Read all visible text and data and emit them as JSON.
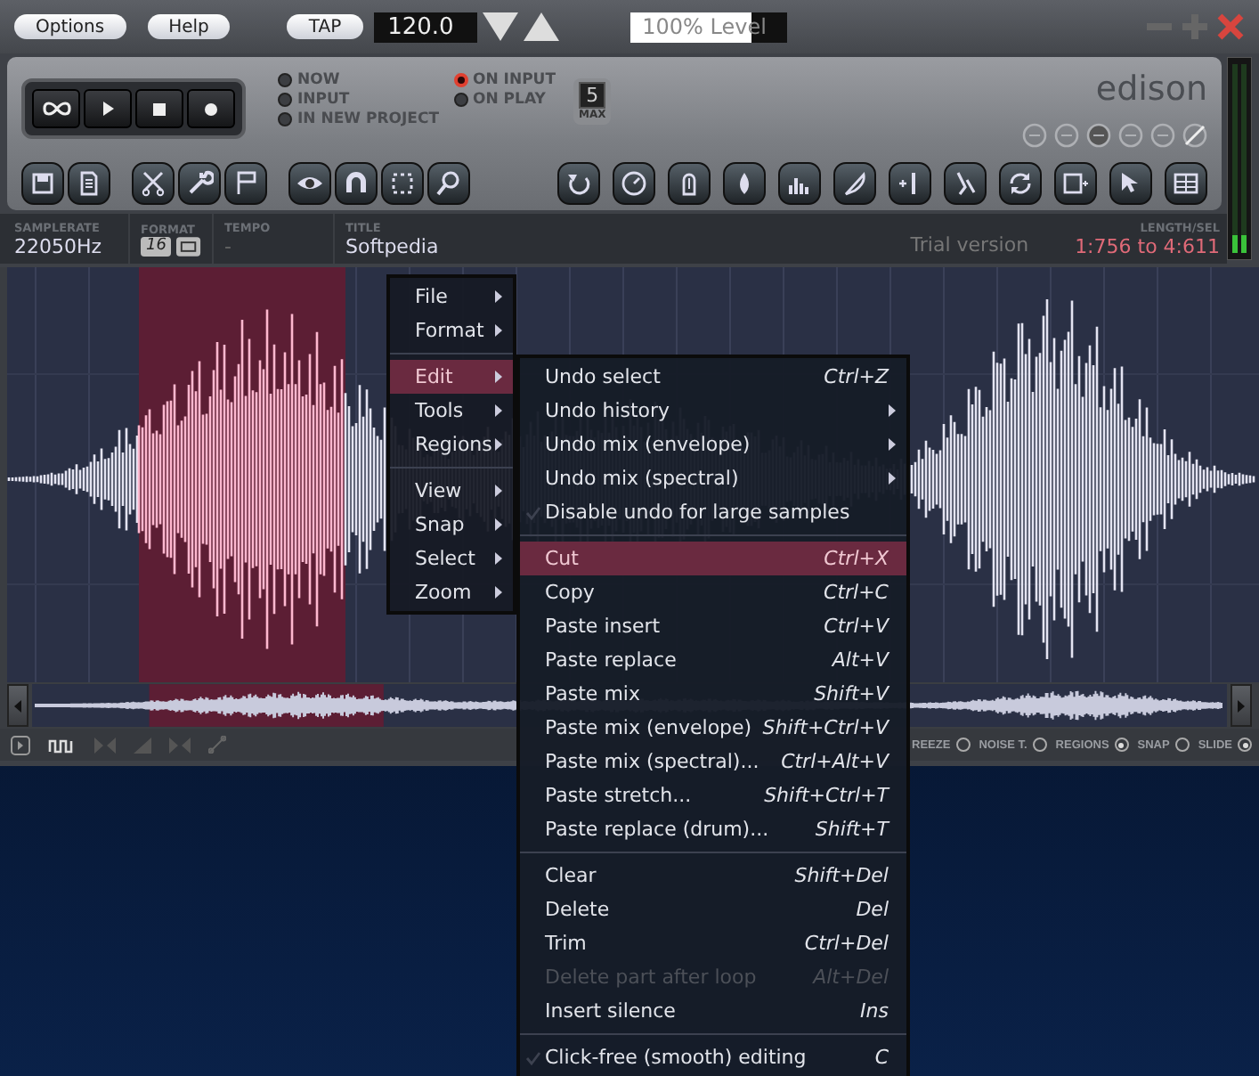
{
  "top_bar": {
    "buttons": [
      "Options",
      "Help",
      "TAP"
    ],
    "tempo": "120.0",
    "level_field": {
      "text": "100% Level",
      "level": 0.78
    }
  },
  "record_options": [
    {
      "label": "NOW",
      "selected": false
    },
    {
      "label": "INPUT",
      "selected": false
    },
    {
      "label": "IN NEW PROJECT",
      "selected": false
    },
    {
      "label": "ON INPUT",
      "selected": true
    },
    {
      "label": "ON PLAY",
      "selected": false
    }
  ],
  "max": {
    "value": "5",
    "label": "MAX"
  },
  "logo": "edison",
  "info": {
    "samplerate": {
      "label": "SAMPLERATE",
      "value": "22050Hz"
    },
    "format": {
      "label": "FORMAT",
      "bits": "16"
    },
    "tempo": {
      "label": "TEMPO",
      "value": "-"
    },
    "title": {
      "label": "TITLE",
      "value": "Softpedia"
    },
    "trial": "Trial version",
    "length": {
      "label": "LENGTH/SEL",
      "value": "1:756 to 4:611"
    }
  },
  "bottom_toggles": [
    {
      "label": "REEZE",
      "selected": false
    },
    {
      "label": "NOISE T.",
      "selected": false
    },
    {
      "label": "REGIONS",
      "selected": true
    },
    {
      "label": "SNAP",
      "selected": false
    },
    {
      "label": "SLIDE",
      "selected": true
    }
  ],
  "menu": {
    "items": [
      {
        "kind": "item",
        "label": "File",
        "selected": false
      },
      {
        "kind": "item",
        "label": "Format",
        "selected": false
      },
      {
        "kind": "separator"
      },
      {
        "kind": "item",
        "label": "Edit",
        "selected": true
      },
      {
        "kind": "item",
        "label": "Tools",
        "selected": false
      },
      {
        "kind": "item",
        "label": "Regions",
        "selected": false
      },
      {
        "kind": "separator"
      },
      {
        "kind": "item",
        "label": "View",
        "selected": false
      },
      {
        "kind": "item",
        "label": "Snap",
        "selected": false
      },
      {
        "kind": "item",
        "label": "Select",
        "selected": false
      },
      {
        "kind": "item",
        "label": "Zoom",
        "selected": false
      }
    ]
  },
  "edit_submenu": {
    "items": [
      {
        "kind": "item",
        "label": "Undo select",
        "shortcut": "Ctrl+Z",
        "selected": false,
        "disabled": false
      },
      {
        "kind": "submenu",
        "label": "Undo history",
        "selected": false,
        "disabled": false
      },
      {
        "kind": "submenu",
        "label": "Undo mix (envelope)",
        "selected": false,
        "disabled": false
      },
      {
        "kind": "submenu",
        "label": "Undo mix (spectral)",
        "selected": false,
        "disabled": false
      },
      {
        "kind": "check",
        "label": "Disable undo for large samples",
        "checked": false,
        "selected": false,
        "disabled": false
      },
      {
        "kind": "separator"
      },
      {
        "kind": "item",
        "label": "Cut",
        "shortcut": "Ctrl+X",
        "selected": true,
        "disabled": false
      },
      {
        "kind": "item",
        "label": "Copy",
        "shortcut": "Ctrl+C",
        "selected": false,
        "disabled": false
      },
      {
        "kind": "item",
        "label": "Paste insert",
        "shortcut": "Ctrl+V",
        "selected": false,
        "disabled": false
      },
      {
        "kind": "item",
        "label": "Paste replace",
        "shortcut": "Alt+V",
        "selected": false,
        "disabled": false
      },
      {
        "kind": "item",
        "label": "Paste mix",
        "shortcut": "Shift+V",
        "selected": false,
        "disabled": false
      },
      {
        "kind": "item",
        "label": "Paste mix (envelope)",
        "shortcut": "Shift+Ctrl+V",
        "selected": false,
        "disabled": false
      },
      {
        "kind": "item",
        "label": "Paste mix (spectral)...",
        "shortcut": "Ctrl+Alt+V",
        "selected": false,
        "disabled": false
      },
      {
        "kind": "item",
        "label": "Paste stretch...",
        "shortcut": "Shift+Ctrl+T",
        "selected": false,
        "disabled": false
      },
      {
        "kind": "item",
        "label": "Paste replace (drum)...",
        "shortcut": "Shift+T",
        "selected": false,
        "disabled": false
      },
      {
        "kind": "separator"
      },
      {
        "kind": "item",
        "label": "Clear",
        "shortcut": "Shift+Del",
        "selected": false,
        "disabled": false
      },
      {
        "kind": "item",
        "label": "Delete",
        "shortcut": "Del",
        "selected": false,
        "disabled": false
      },
      {
        "kind": "item",
        "label": "Trim",
        "shortcut": "Ctrl+Del",
        "selected": false,
        "disabled": false
      },
      {
        "kind": "item",
        "label": "Delete part after loop",
        "shortcut": "Alt+Del",
        "selected": false,
        "disabled": true
      },
      {
        "kind": "item",
        "label": "Insert silence",
        "shortcut": "Ins",
        "selected": false,
        "disabled": false
      },
      {
        "kind": "separator"
      },
      {
        "kind": "check",
        "label": "Click-free (smooth) editing",
        "shortcut": "C",
        "checked": false,
        "selected": false,
        "disabled": false
      }
    ]
  }
}
